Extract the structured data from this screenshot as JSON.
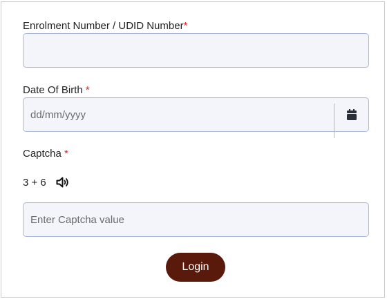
{
  "form": {
    "enrolment": {
      "label": "Enrolment Number / UDID Number",
      "required_mark": "*",
      "value": ""
    },
    "dob": {
      "label": "Date Of Birth",
      "required_mark": "*",
      "placeholder": "dd/mm/yyyy",
      "icon": "calendar-icon"
    },
    "captcha": {
      "label": "Captcha",
      "required_mark": "*",
      "question": "3 + 6",
      "audio_icon": "speaker-icon",
      "placeholder": "Enter Captcha value"
    },
    "login_label": "Login"
  },
  "colors": {
    "button_bg": "#5a1a0b",
    "required": "#e02020",
    "field_border": "#a9b6dc",
    "field_bg": "#f4f5fb"
  }
}
